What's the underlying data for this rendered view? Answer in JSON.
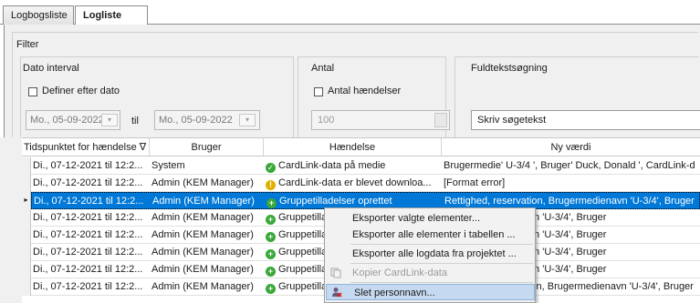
{
  "tabs": [
    "Logbogsliste",
    "Logliste"
  ],
  "filter": {
    "title": "Filter",
    "date_interval": {
      "title": "Dato interval",
      "checkbox_label": "Definer efter dato",
      "from": "Mo., 05-09-2022",
      "to_label": "til",
      "to": "Mo., 05-09-2022"
    },
    "count": {
      "title": "Antal",
      "checkbox_label": "Antal hændelser",
      "value": "100"
    },
    "fulltext": {
      "title": "Fuldtekstsøgning",
      "value": "Skriv søgetekst"
    }
  },
  "grid": {
    "columns": [
      "Tidspunktet for hændelse ∇",
      "Bruger",
      "Hændelse",
      "Ny værdi"
    ],
    "rows": [
      {
        "time": "Di., 07-12-2021 til 12:2...",
        "user": "System",
        "event": "CardLink-data på medie",
        "icon": "check-green",
        "value": "Brugermedie' U-3/4 ', Bruger' Duck, Donald ', CardLink-d"
      },
      {
        "time": "Di., 07-12-2021 til 12:2...",
        "user": "Admin (KEM Manager)",
        "event": "CardLink-data er blevet downloa...",
        "icon": "warning-yellow",
        "value": "[Format error]"
      },
      {
        "time": "Di., 07-12-2021 til 12:2...",
        "user": "Admin (KEM Manager)",
        "event": "Gruppetilladelser oprettet",
        "icon": "plus-green",
        "value": "Rettighed, reservation, Brugermedienavn 'U-3/4', Bruger"
      },
      {
        "time": "Di., 07-12-2021 til 12:2...",
        "user": "Admin (KEM Manager)",
        "event": "Gruppetilla",
        "icon": "plus-green",
        "value": "on, Brugermedienavn 'U-3/4', Bruger"
      },
      {
        "time": "Di., 07-12-2021 til 12:2...",
        "user": "Admin (KEM Manager)",
        "event": "Gruppetilla",
        "icon": "plus-green",
        "value": "on, Brugermedienavn 'U-3/4', Bruger"
      },
      {
        "time": "Di., 07-12-2021 til 12:2...",
        "user": "Admin (KEM Manager)",
        "event": "Gruppetilla",
        "icon": "plus-green",
        "value": "on, Brugermedienavn 'U-3/4', Bruger"
      },
      {
        "time": "Di., 07-12-2021 til 12:2...",
        "user": "Admin (KEM Manager)",
        "event": "Gruppetilla",
        "icon": "plus-green",
        "value": "on, Brugermedienavn 'U-3/4', Bruger"
      },
      {
        "time": "Di., 07-12-2021 til 12:2...",
        "user": "Admin (KEM Manager)",
        "event": "Gruppetilladelser oprettet",
        "icon": "plus-green",
        "value": "Rettighed, reservation, Brugermedienavn 'U-3/4', Bruger"
      }
    ]
  },
  "context_menu": {
    "items": [
      {
        "label": "Eksporter valgte elementer...",
        "disabled": false
      },
      {
        "label": "Eksporter alle elementer i tabellen ...",
        "disabled": false
      },
      {
        "label": "Eksporter alle logdata fra projektet ...",
        "disabled": false
      },
      {
        "label": "Kopier CardLink-data",
        "disabled": true
      },
      {
        "label": "Slet personnavn...",
        "disabled": false,
        "highlighted": true
      }
    ]
  },
  "colors": {
    "selection": "#0078d7",
    "icon_green": "#3aa83a",
    "icon_yellow": "#e0b000",
    "menu_highlight": "#c5daf0"
  }
}
